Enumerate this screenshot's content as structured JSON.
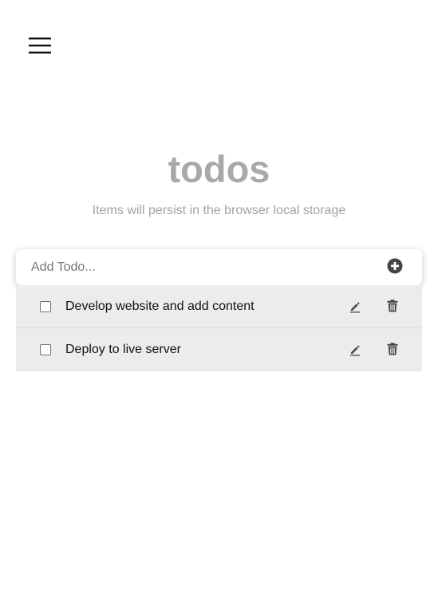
{
  "header": {
    "menu_icon": "hamburger-menu-icon"
  },
  "main": {
    "title": "todos",
    "subtitle": "Items will persist in the browser local storage"
  },
  "add_todo": {
    "placeholder": "Add Todo...",
    "value": "",
    "add_icon": "plus-circle-icon"
  },
  "todos": [
    {
      "text": "Develop website and add content",
      "completed": false,
      "edit_icon": "pencil-icon",
      "delete_icon": "trash-icon"
    },
    {
      "text": "Deploy to live server",
      "completed": false,
      "edit_icon": "pencil-icon",
      "delete_icon": "trash-icon"
    }
  ],
  "colors": {
    "title": "#a9a9a9",
    "subtitle": "#a3a3a3",
    "row_background": "#ececec",
    "icon": "#444444"
  }
}
